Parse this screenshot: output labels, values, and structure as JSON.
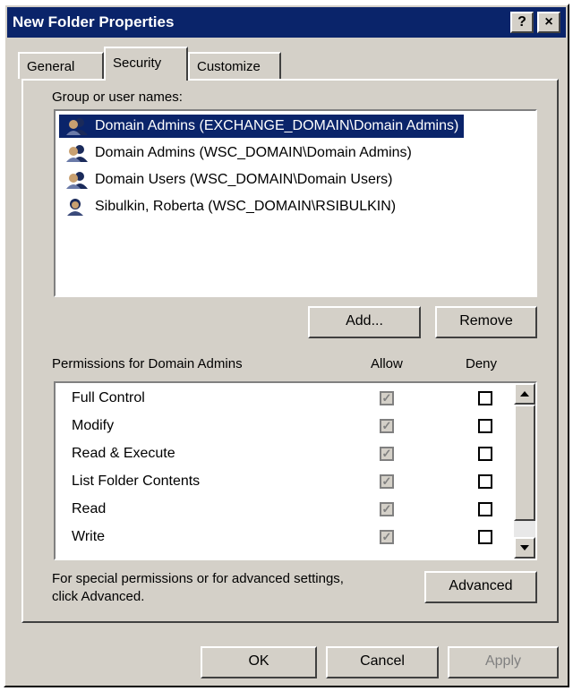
{
  "window": {
    "title": "New Folder Properties",
    "help_label": "?",
    "close_label": "×"
  },
  "tabs": [
    {
      "label": "General"
    },
    {
      "label": "Security"
    },
    {
      "label": "Customize"
    }
  ],
  "active_tab": "Security",
  "security": {
    "group_label": "Group or user names:",
    "users": [
      {
        "label": "Domain Admins (EXCHANGE_DOMAIN\\Domain Admins)",
        "icon": "group-icon",
        "selected": true
      },
      {
        "label": "Domain Admins (WSC_DOMAIN\\Domain Admins)",
        "icon": "group-icon",
        "selected": false
      },
      {
        "label": "Domain Users (WSC_DOMAIN\\Domain Users)",
        "icon": "group-icon",
        "selected": false
      },
      {
        "label": "Sibulkin, Roberta (WSC_DOMAIN\\RSIBULKIN)",
        "icon": "user-icon",
        "selected": false
      }
    ],
    "add_label": "Add...",
    "remove_label": "Remove",
    "permissions_label": "Permissions for Domain Admins",
    "allow_header": "Allow",
    "deny_header": "Deny",
    "permissions": [
      {
        "name": "Full Control",
        "allow": true,
        "deny": false
      },
      {
        "name": "Modify",
        "allow": true,
        "deny": false
      },
      {
        "name": "Read & Execute",
        "allow": true,
        "deny": false
      },
      {
        "name": "List Folder Contents",
        "allow": true,
        "deny": false
      },
      {
        "name": "Read",
        "allow": true,
        "deny": false
      },
      {
        "name": "Write",
        "allow": true,
        "deny": false
      }
    ],
    "special_text_line1": "For special permissions or for advanced settings,",
    "special_text_line2": "click Advanced.",
    "advanced_label": "Advanced"
  },
  "footer": {
    "ok_label": "OK",
    "cancel_label": "Cancel",
    "apply_label": "Apply"
  },
  "colors": {
    "titlebar": "#0a246a",
    "face": "#d4d0c8",
    "selection": "#0a246a"
  }
}
